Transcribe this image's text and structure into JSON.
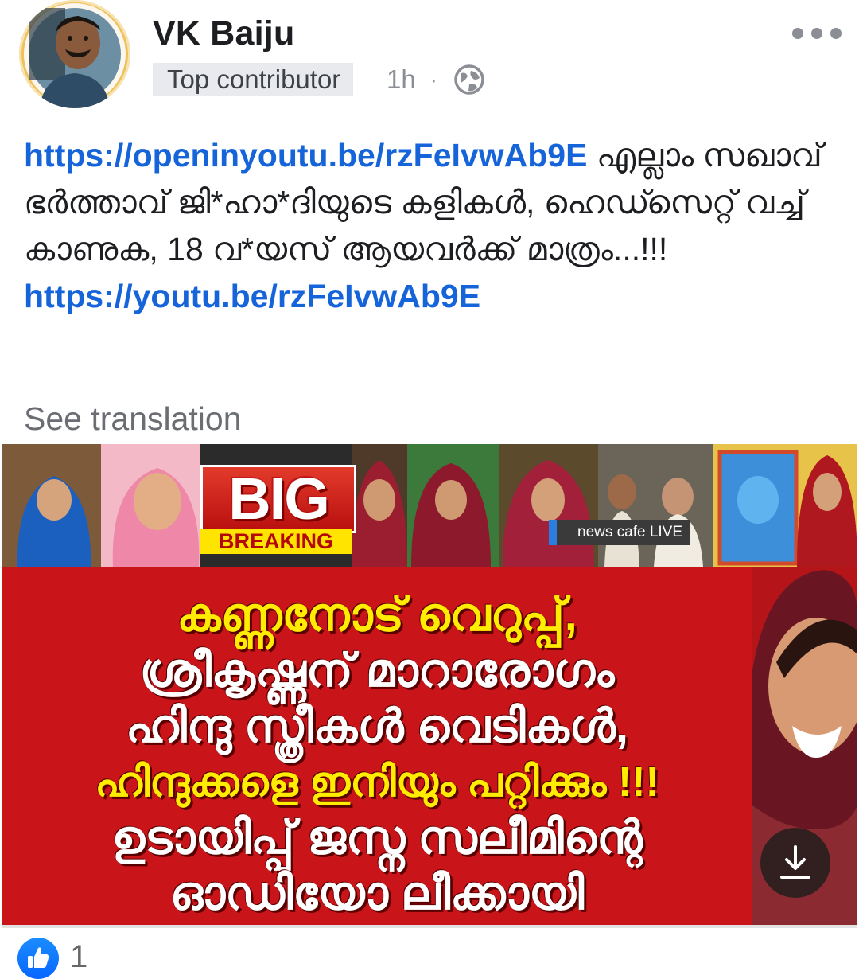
{
  "post": {
    "author": "VK Baiju",
    "badge": "Top contributor",
    "time": "1h",
    "separator": "·",
    "privacy_icon": "globe-icon",
    "more_icon": "more-horizontal-icon"
  },
  "text": {
    "link1": "https://openinyoutu.be/rzFeIvwAb9E",
    "body": " എല്ലാം സഖാവ് ഭർത്താവ് ജി*ഹാ*ദിയുടെ കളികൾ, ഹെഡ്സെറ്റ് വച്ച് കാണുക, 18 വ*യസ് ആയവർക്ക് മാത്രം...!!! ",
    "link2": "https://youtu.be/rzFeIvwAb9E"
  },
  "see_translation": "See translation",
  "media": {
    "big_text": "BIG",
    "breaking_text": "BREAKING",
    "channel_label": "news cafe LIVE",
    "headline_lines": [
      "കണ്ണനോട് വെറുപ്പ്,",
      "ശ്രീകൃഷ്ണന് മാറാരോഗം",
      "ഹിന്ദു സ്ത്രീകൾ വെടികൾ,",
      "ഹിന്ദുക്കളെ ഇനിയും പറ്റിക്കും !!!",
      "ഉടായിപ്പ് ജസ്ന സലീമിന്റെ",
      "ഓഡിയോ ലീക്കായി"
    ],
    "download_icon": "download-icon",
    "colors": {
      "background": "#c9151a",
      "headline_yellow": "#ffec00",
      "headline_white": "#ffffff",
      "breaking_bg": "#ffe400"
    }
  },
  "reactions": {
    "icon": "like-icon",
    "count": "1"
  },
  "colors": {
    "link": "#1664d9",
    "muted": "#8b8f95",
    "like_blue": "#0866ff"
  }
}
